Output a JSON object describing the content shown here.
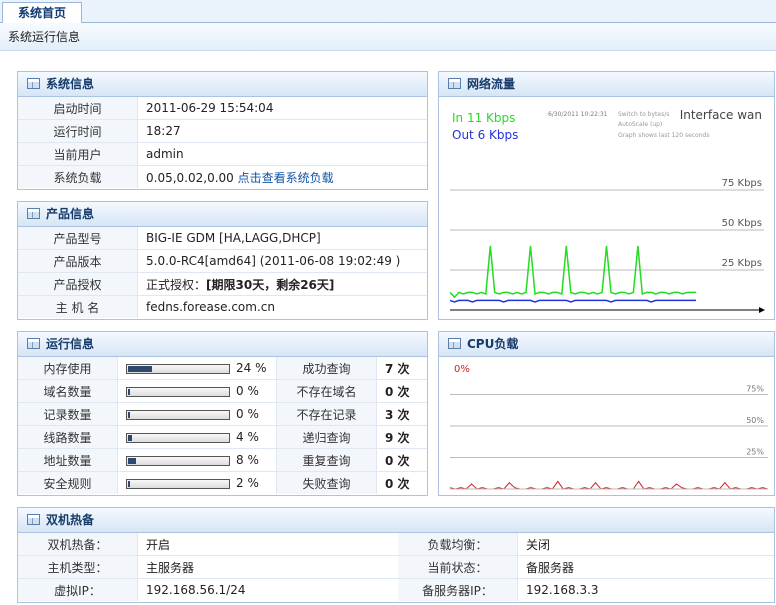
{
  "tab": {
    "label": "系统首页"
  },
  "breadcrumb": "系统运行信息",
  "system_info": {
    "title": "系统信息",
    "rows": [
      {
        "label": "启动时间",
        "value": "2011-06-29 15:54:04"
      },
      {
        "label": "运行时间",
        "value": "18:27"
      },
      {
        "label": "当前用户",
        "value": "admin"
      },
      {
        "label": "系统负载",
        "value": "0.05,0.02,0.00",
        "link": "点击查看系统负载"
      }
    ]
  },
  "product_info": {
    "title": "产品信息",
    "rows": [
      {
        "label": "产品型号",
        "value": "BIG-IE GDM [HA,LAGG,DHCP]"
      },
      {
        "label": "产品版本",
        "value": "5.0.0-RC4[amd64] (2011-06-08 19:02:49 )"
      },
      {
        "label": "产品授权",
        "value_prefix": "正式授权：",
        "value": "[期限30天，剩余26天]"
      },
      {
        "label": "主 机 名",
        "value": "fedns.forease.com.cn"
      }
    ]
  },
  "runtime_info": {
    "title": "运行信息",
    "rows": [
      {
        "label": "内存使用",
        "percent": 24,
        "percent_text": "24 %",
        "qlabel": "成功查询",
        "qvalue": "7 次"
      },
      {
        "label": "域名数量",
        "percent": 0,
        "percent_text": "0 %",
        "qlabel": "不存在域名",
        "qvalue": "0 次"
      },
      {
        "label": "记录数量",
        "percent": 0,
        "percent_text": "0 %",
        "qlabel": "不存在记录",
        "qvalue": "3 次"
      },
      {
        "label": "线路数量",
        "percent": 4,
        "percent_text": "4 %",
        "qlabel": "递归查询",
        "qvalue": "9 次"
      },
      {
        "label": "地址数量",
        "percent": 8,
        "percent_text": "8 %",
        "qlabel": "重复查询",
        "qvalue": "0 次"
      },
      {
        "label": "安全规则",
        "percent": 2,
        "percent_text": "2 %",
        "qlabel": "失败查询",
        "qvalue": "0 次"
      }
    ]
  },
  "ha_info": {
    "title": "双机热备",
    "rows": [
      {
        "l1": "双机热备：",
        "v1": "开启",
        "l2": "负载均衡：",
        "v2": "关闭"
      },
      {
        "l1": "主机类型：",
        "v1": "主服务器",
        "l2": "当前状态：",
        "v2": "备服务器"
      },
      {
        "l1": "虚拟IP：",
        "v1": "192.168.56.1/24",
        "l2": "备服务器IP：",
        "v2": "192.168.3.3"
      }
    ]
  },
  "network": {
    "title": "网络流量",
    "in_label": "In   11 Kbps",
    "out_label": "Out  6 Kbps",
    "timestamp": "6/30/2011 10:22:31",
    "switch_text": "Switch to bytes/s",
    "autoscale_text": "AutoScale (up)",
    "graph_text": "Graph shows last 120 seconds",
    "interface_text": "Interface wan",
    "colors": {
      "in": "#22dd22",
      "out": "#2233dd"
    }
  },
  "cpu": {
    "title": "CPU负载",
    "current": "0%",
    "color": "#cc2222"
  },
  "chart_data": [
    {
      "type": "line",
      "title": "Interface wan",
      "ylabel": "",
      "y_ticks": [
        "25 Kbps",
        "50 Kbps",
        "75 Kbps"
      ],
      "tick_values": [
        25,
        50,
        75
      ],
      "ylim": [
        0,
        100
      ],
      "series": [
        {
          "name": "In",
          "values": [
            11,
            8,
            11,
            10,
            11,
            11,
            10,
            11,
            10,
            40,
            11,
            10,
            11,
            11,
            10,
            11,
            10,
            11,
            40,
            10,
            11,
            11,
            10,
            11,
            11,
            10,
            40,
            11,
            10,
            11,
            11,
            10,
            11,
            10,
            11,
            40,
            11,
            10,
            11,
            11,
            10,
            11,
            40,
            10,
            11,
            11,
            10,
            11,
            11,
            10,
            11,
            11,
            10,
            11,
            11,
            11
          ]
        },
        {
          "name": "Out",
          "values": [
            6,
            5,
            6,
            6,
            6,
            5,
            6,
            6,
            6,
            6,
            6,
            6,
            5,
            6,
            6,
            6,
            6,
            6,
            6,
            5,
            6,
            6,
            6,
            6,
            6,
            6,
            6,
            5,
            6,
            6,
            6,
            6,
            6,
            6,
            6,
            6,
            5,
            6,
            6,
            6,
            6,
            6,
            6,
            6,
            6,
            5,
            6,
            6,
            6,
            6,
            6,
            6,
            6,
            6,
            6,
            6
          ]
        }
      ]
    },
    {
      "type": "line",
      "title": "CPU负载",
      "y_ticks": [
        "25%",
        "50%",
        "75%"
      ],
      "tick_values": [
        25,
        50,
        75
      ],
      "ylim": [
        0,
        100
      ],
      "series": [
        {
          "name": "CPU",
          "values": [
            1,
            0,
            1,
            0,
            4,
            0,
            1,
            0,
            0,
            1,
            0,
            5,
            1,
            0,
            0,
            1,
            0,
            0,
            1,
            0,
            6,
            0,
            1,
            0,
            0,
            1,
            0,
            5,
            0,
            1,
            0,
            0,
            1,
            0,
            0,
            6,
            0,
            1,
            0,
            0,
            1,
            0,
            4,
            1,
            0,
            0,
            1,
            0,
            0,
            1,
            0,
            5,
            0,
            1,
            0,
            0,
            1,
            0,
            1,
            0
          ]
        }
      ]
    }
  ]
}
